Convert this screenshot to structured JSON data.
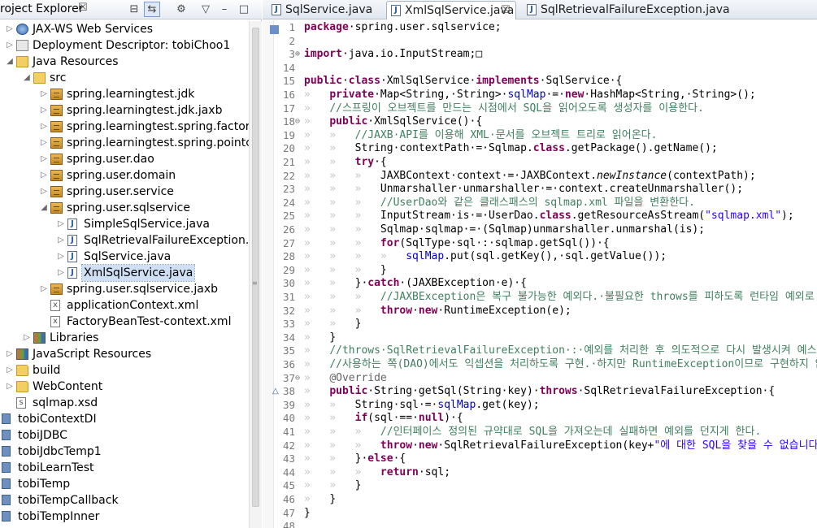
{
  "explorer": {
    "title": "roject Explorer",
    "close": "☒",
    "toolbar": [
      "⊟",
      "⇆",
      "⚙",
      "▽",
      "–",
      "□"
    ],
    "rows": [
      {
        "depth": 0,
        "toggle": "▷",
        "icon": "ic-web",
        "label": "JAX-WS Web Services"
      },
      {
        "depth": 0,
        "toggle": "▷",
        "icon": "ic-desc",
        "label": "Deployment Descriptor: tobiChoo1"
      },
      {
        "depth": 0,
        "toggle": "◢",
        "icon": "ic-src",
        "label": "Java Resources"
      },
      {
        "depth": 1,
        "toggle": "◢",
        "icon": "ic-src",
        "label": "src"
      },
      {
        "depth": 2,
        "toggle": "▷",
        "icon": "ic-pkg",
        "label": "spring.learningtest.jdk"
      },
      {
        "depth": 2,
        "toggle": "▷",
        "icon": "ic-pkg",
        "label": "spring.learningtest.jdk.jaxb"
      },
      {
        "depth": 2,
        "toggle": "▷",
        "icon": "ic-pkg",
        "label": "spring.learningtest.spring.factorybear"
      },
      {
        "depth": 2,
        "toggle": "▷",
        "icon": "ic-pkg",
        "label": "spring.learningtest.spring.pointcut"
      },
      {
        "depth": 2,
        "toggle": "▷",
        "icon": "ic-pkg",
        "label": "spring.user.dao"
      },
      {
        "depth": 2,
        "toggle": "▷",
        "icon": "ic-pkg",
        "label": "spring.user.domain"
      },
      {
        "depth": 2,
        "toggle": "▷",
        "icon": "ic-pkg",
        "label": "spring.user.service"
      },
      {
        "depth": 2,
        "toggle": "◢",
        "icon": "ic-pkg",
        "label": "spring.user.sqlservice"
      },
      {
        "depth": 3,
        "toggle": "▷",
        "icon": "ic-java",
        "label": "SimpleSqlService.java"
      },
      {
        "depth": 3,
        "toggle": "▷",
        "icon": "ic-java",
        "label": "SqlRetrievalFailureException.java"
      },
      {
        "depth": 3,
        "toggle": "▷",
        "icon": "ic-java",
        "label": "SqlService.java"
      },
      {
        "depth": 3,
        "toggle": "▷",
        "icon": "ic-java",
        "label": "XmlSqlService.java",
        "selected": true
      },
      {
        "depth": 2,
        "toggle": "▷",
        "icon": "ic-pkg",
        "label": "spring.user.sqlservice.jaxb"
      },
      {
        "depth": 2,
        "toggle": "",
        "icon": "ic-xml",
        "label": "applicationContext.xml"
      },
      {
        "depth": 2,
        "toggle": "",
        "icon": "ic-xml",
        "label": "FactoryBeanTest-context.xml"
      },
      {
        "depth": 1,
        "toggle": "▷",
        "icon": "ic-lib",
        "label": "Libraries"
      },
      {
        "depth": 0,
        "toggle": "▷",
        "icon": "ic-lib",
        "label": "JavaScript Resources"
      },
      {
        "depth": 0,
        "toggle": "▷",
        "icon": "ic-folder",
        "label": "build"
      },
      {
        "depth": 0,
        "toggle": "▷",
        "icon": "ic-folder",
        "label": "WebContent"
      },
      {
        "depth": 0,
        "toggle": "",
        "icon": "ic-xsd",
        "label": "sqlmap.xsd"
      },
      {
        "depth": -1,
        "toggle": "",
        "icon": "ic-project",
        "label": "tobiContextDI"
      },
      {
        "depth": -1,
        "toggle": "",
        "icon": "ic-project",
        "label": "tobiJDBC"
      },
      {
        "depth": -1,
        "toggle": "",
        "icon": "ic-project",
        "label": "tobiJdbcTemp1"
      },
      {
        "depth": -1,
        "toggle": "",
        "icon": "ic-project",
        "label": "tobiLearnTest"
      },
      {
        "depth": -1,
        "toggle": "",
        "icon": "ic-project",
        "label": "tobiTemp"
      },
      {
        "depth": -1,
        "toggle": "",
        "icon": "ic-project",
        "label": "tobiTempCallback"
      },
      {
        "depth": -1,
        "toggle": "",
        "icon": "ic-project",
        "label": "tobiTempInner"
      }
    ]
  },
  "editor": {
    "tabs": [
      {
        "label": "SqlService.java",
        "active": false
      },
      {
        "label": "XmlSqlService.java",
        "active": true,
        "close": "☒"
      },
      {
        "label": "SqlRetrievalFailureException.java",
        "active": false
      }
    ],
    "lines": [
      {
        "n": "1",
        "f": "",
        "t": [
          [
            "kw",
            "package"
          ],
          [
            "",
            "·spring.user.sqlservice;"
          ]
        ]
      },
      {
        "n": "2",
        "f": "",
        "t": []
      },
      {
        "n": "3",
        "f": "⊕",
        "t": [
          [
            "kw",
            "import"
          ],
          [
            "",
            "·java.io.InputStream;□"
          ]
        ]
      },
      {
        "n": "14",
        "f": "",
        "t": []
      },
      {
        "n": "15",
        "f": "",
        "t": [
          [
            "kw",
            "public"
          ],
          [
            "",
            "·"
          ],
          [
            "kw",
            "class"
          ],
          [
            "",
            "·XmlSqlService·"
          ],
          [
            "kw",
            "implements"
          ],
          [
            "",
            "·SqlService·{"
          ]
        ]
      },
      {
        "n": "16",
        "f": "",
        "t": [
          [
            "ws",
            "»   "
          ],
          [
            "kw",
            "private"
          ],
          [
            "",
            "·Map<String,·String>·"
          ],
          [
            "fld",
            "sqlMap"
          ],
          [
            "",
            "·=·"
          ],
          [
            "kw",
            "new"
          ],
          [
            "",
            "·HashMap<String,·String>();"
          ]
        ]
      },
      {
        "n": "17",
        "f": "",
        "t": [
          [
            "ws",
            "»   "
          ],
          [
            "cm",
            "//스프링이 오브젝트를 만드는 시점에서 SQL을 읽어오도록 생성자를 이용한다."
          ]
        ]
      },
      {
        "n": "18",
        "f": "⊖",
        "t": [
          [
            "ws",
            "»   "
          ],
          [
            "kw",
            "public"
          ],
          [
            "",
            "·XmlSqlService()·{"
          ]
        ]
      },
      {
        "n": "19",
        "f": "",
        "t": [
          [
            "ws",
            "»   »   "
          ],
          [
            "cm",
            "//JAXB·API를 이용해 XML·문서를 오브젝트 트리로 읽어온다."
          ]
        ]
      },
      {
        "n": "20",
        "f": "",
        "t": [
          [
            "ws",
            "»   »   "
          ],
          [
            "",
            "String·contextPath·=·Sqlmap."
          ],
          [
            "kw",
            "class"
          ],
          [
            "",
            ".getPackage().getName();"
          ]
        ]
      },
      {
        "n": "21",
        "f": "",
        "t": [
          [
            "ws",
            "»   »   "
          ],
          [
            "kw",
            "try"
          ],
          [
            "",
            "·{"
          ]
        ]
      },
      {
        "n": "22",
        "f": "",
        "t": [
          [
            "ws",
            "»   »   »   "
          ],
          [
            "",
            "JAXBContext·context·=·JAXBContext."
          ],
          [
            "it",
            "newInstance"
          ],
          [
            "",
            "(contextPath);"
          ]
        ]
      },
      {
        "n": "23",
        "f": "",
        "t": [
          [
            "ws",
            "»   »   »   "
          ],
          [
            "",
            "Unmarshaller·unmarshaller·=·context.createUnmarshaller();"
          ]
        ]
      },
      {
        "n": "24",
        "f": "",
        "t": [
          [
            "ws",
            "»   »   »   "
          ],
          [
            "cm",
            "//UserDao와 같은 클래스패스의 sqlmap.xml 파일을 변환한다."
          ]
        ]
      },
      {
        "n": "25",
        "f": "",
        "t": [
          [
            "ws",
            "»   »   »   "
          ],
          [
            "",
            "InputStream·is·=·UserDao."
          ],
          [
            "kw",
            "class"
          ],
          [
            "",
            ".getResourceAsStream("
          ],
          [
            "str",
            "\"sqlmap.xml\""
          ],
          [
            "",
            ");"
          ]
        ]
      },
      {
        "n": "26",
        "f": "",
        "t": [
          [
            "ws",
            "»   »   »   "
          ],
          [
            "",
            "Sqlmap·sqlmap·=·(Sqlmap)unmarshaller.unmarshal(is);"
          ]
        ]
      },
      {
        "n": "27",
        "f": "",
        "t": [
          [
            "ws",
            "»   »   »   "
          ],
          [
            "kw",
            "for"
          ],
          [
            "",
            "(SqlType·sql·:·sqlmap.getSql())·{"
          ]
        ]
      },
      {
        "n": "28",
        "f": "",
        "t": [
          [
            "ws",
            "»   »   »   »   "
          ],
          [
            "fld",
            "sqlMap"
          ],
          [
            "",
            ".put(sql.getKey(),·sql.getValue());"
          ]
        ]
      },
      {
        "n": "29",
        "f": "",
        "t": [
          [
            "ws",
            "»   »   »   "
          ],
          [
            "",
            "}"
          ]
        ]
      },
      {
        "n": "30",
        "f": "",
        "t": [
          [
            "ws",
            "»   »   "
          ],
          [
            "",
            "}·"
          ],
          [
            "kw",
            "catch"
          ],
          [
            "",
            "·(JAXBException·e)·{"
          ]
        ]
      },
      {
        "n": "31",
        "f": "",
        "t": [
          [
            "ws",
            "»   »   »   "
          ],
          [
            "cm",
            "//JAXBException은 복구 불가능한 예외다.·불필요한 throws를 피하도록 런타임 예외로 포장해서 던짐."
          ]
        ]
      },
      {
        "n": "32",
        "f": "",
        "t": [
          [
            "ws",
            "»   »   »   "
          ],
          [
            "kw",
            "throw"
          ],
          [
            "",
            "·"
          ],
          [
            "kw",
            "new"
          ],
          [
            "",
            "·RuntimeException(e);"
          ]
        ]
      },
      {
        "n": "33",
        "f": "",
        "t": [
          [
            "ws",
            "»   »   "
          ],
          [
            "",
            "}"
          ]
        ]
      },
      {
        "n": "34",
        "f": "",
        "t": [
          [
            "ws",
            "»   "
          ],
          [
            "",
            "}"
          ]
        ]
      },
      {
        "n": "35",
        "f": "",
        "t": [
          [
            "ws",
            "»   "
          ],
          [
            "cm",
            "//throws·SqlRetrievalFailureException·:·예외를 처리한 후 의도적으로 다시 발생시켜 예스트톨"
          ]
        ]
      },
      {
        "n": "36",
        "f": "",
        "t": [
          [
            "ws",
            "»   "
          ],
          [
            "cm",
            "//사용하는 쪽(DAO)에서도 익셉션을 처리하도록 구현.·하지만 RuntimeException이므로 구현하지 않아도 괜찮음."
          ]
        ]
      },
      {
        "n": "37",
        "f": "⊖",
        "t": [
          [
            "ws",
            "»   "
          ],
          [
            "ann",
            "@Override"
          ]
        ]
      },
      {
        "n": "38",
        "f": "",
        "t": [
          [
            "ws",
            "»   "
          ],
          [
            "kw",
            "public"
          ],
          [
            "",
            "·String·getSql(String·key)·"
          ],
          [
            "kw",
            "throws"
          ],
          [
            "",
            "·SqlRetrievalFailureException·{"
          ]
        ]
      },
      {
        "n": "39",
        "f": "",
        "t": [
          [
            "ws",
            "»   »   "
          ],
          [
            "",
            "String·sql·=·"
          ],
          [
            "fld",
            "sqlMap"
          ],
          [
            "",
            ".get(key);"
          ]
        ]
      },
      {
        "n": "40",
        "f": "",
        "t": [
          [
            "ws",
            "»   »   "
          ],
          [
            "kw",
            "if"
          ],
          [
            "",
            "(sql·==·"
          ],
          [
            "kw",
            "null"
          ],
          [
            "",
            ")·{"
          ]
        ]
      },
      {
        "n": "41",
        "f": "",
        "t": [
          [
            "ws",
            "»   »   »   "
          ],
          [
            "cm",
            "//인터페이스 정의된 규약대로 SQL을 가져오는데 실패하면 예외를 던지게 한다."
          ]
        ]
      },
      {
        "n": "42",
        "f": "",
        "t": [
          [
            "ws",
            "»   »   »   "
          ],
          [
            "kw",
            "throw"
          ],
          [
            "",
            "·"
          ],
          [
            "kw",
            "new"
          ],
          [
            "",
            "·SqlRetrievalFailureException(key+"
          ],
          [
            "str",
            "\"에 대한 SQL을 찾을 수 없습니다.\""
          ],
          [
            "",
            ");"
          ]
        ]
      },
      {
        "n": "43",
        "f": "",
        "t": [
          [
            "ws",
            "»   »   "
          ],
          [
            "",
            "}·"
          ],
          [
            "kw",
            "else"
          ],
          [
            "",
            "·{"
          ]
        ]
      },
      {
        "n": "44",
        "f": "",
        "t": [
          [
            "ws",
            "»   »   »   "
          ],
          [
            "kw",
            "return"
          ],
          [
            "",
            "·sql;"
          ]
        ]
      },
      {
        "n": "45",
        "f": "",
        "t": [
          [
            "ws",
            "»   »   "
          ],
          [
            "",
            "}"
          ]
        ]
      },
      {
        "n": "46",
        "f": "",
        "t": [
          [
            "ws",
            "»   "
          ],
          [
            "",
            "}"
          ]
        ]
      },
      {
        "n": "47",
        "f": "",
        "t": [
          [
            "",
            "}"
          ]
        ]
      },
      {
        "n": "48",
        "f": "",
        "t": []
      }
    ]
  }
}
